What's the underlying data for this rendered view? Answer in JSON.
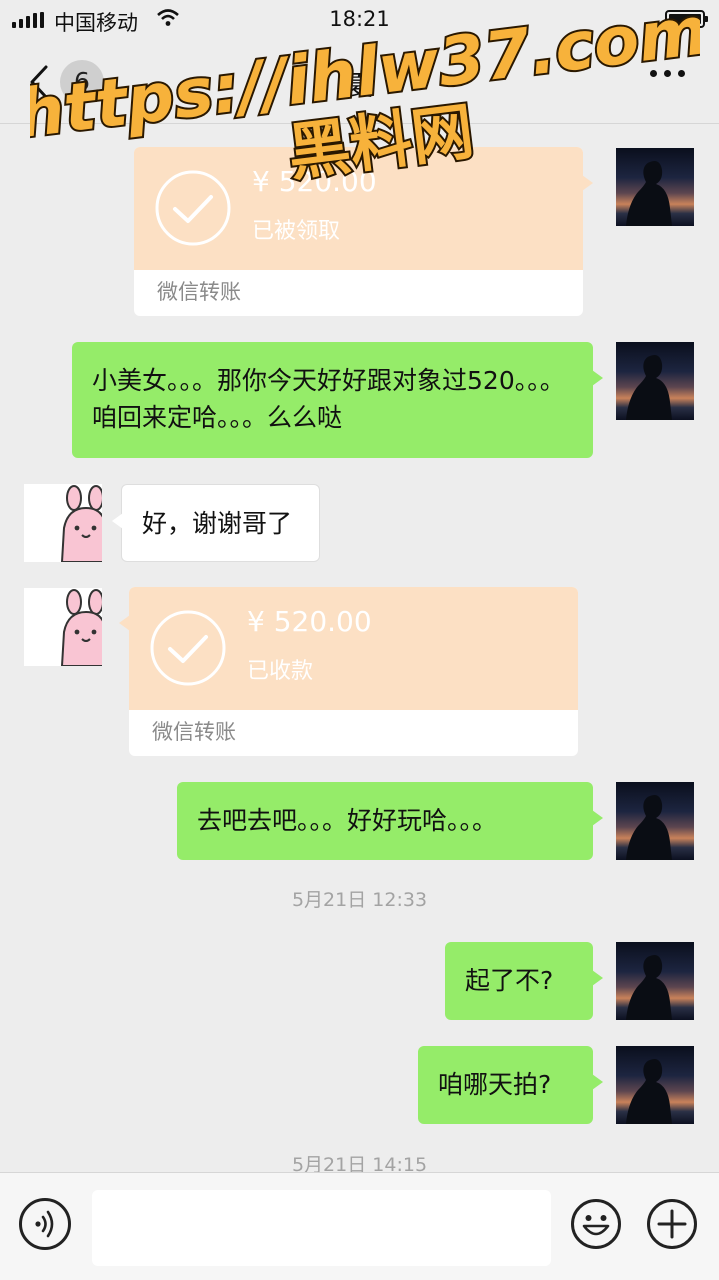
{
  "status_bar": {
    "carrier": "中国移动",
    "time": "18:21",
    "battery_level": 1.0
  },
  "nav": {
    "back_icon": "chevron-left-icon",
    "unread_count": "6",
    "title": "夏",
    "more_icon": "ellipsis-icon"
  },
  "watermark": {
    "url": "https://ihlw37.com",
    "name": "黑料网"
  },
  "messages": [
    {
      "type": "transfer",
      "side": "right",
      "amount": "¥ 520.00",
      "status": "已被领取",
      "label": "微信转账"
    },
    {
      "type": "text",
      "side": "right",
      "text": "小美女。。。那你今天好好跟对象过520。。。咱回来定哈。。。么么哒"
    },
    {
      "type": "text",
      "side": "left",
      "text": "好，谢谢哥了"
    },
    {
      "type": "transfer",
      "side": "left",
      "amount": "¥ 520.00",
      "status": "已收款",
      "label": "微信转账"
    },
    {
      "type": "text",
      "side": "right",
      "text": "去吧去吧。。。好好玩哈。。。"
    },
    {
      "type": "timestamp",
      "text": "5月21日 12:33"
    },
    {
      "type": "text",
      "side": "right",
      "text": "起了不?"
    },
    {
      "type": "text",
      "side": "right",
      "text": "咱哪天拍?"
    },
    {
      "type": "timestamp",
      "text": "5月21日 14:15"
    }
  ],
  "input_bar": {
    "voice_icon": "voice-icon",
    "input_value": "",
    "emoji_icon": "emoji-icon",
    "plus_icon": "plus-icon"
  },
  "colors": {
    "background": "#ededed",
    "sent_bubble": "#95ec69",
    "received_bubble": "#ffffff",
    "transfer_card": "#fce0c4",
    "watermark_fill": "#f7b23b"
  }
}
